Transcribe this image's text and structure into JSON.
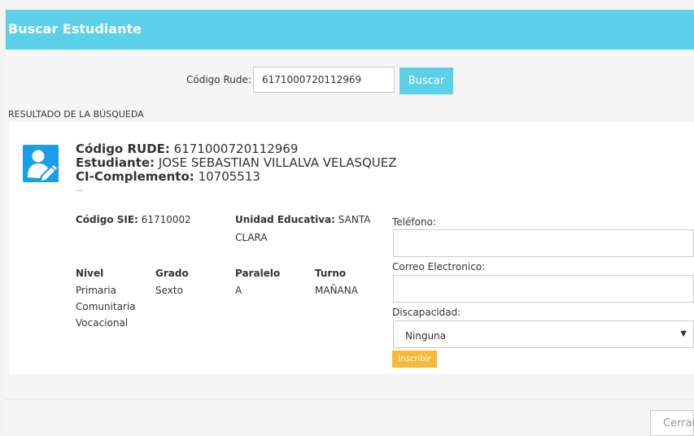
{
  "header": {
    "title": "Buscar Estudiante"
  },
  "search": {
    "label": "Código Rude:",
    "value": "6171000720112969",
    "button_label": "Buscar"
  },
  "results": {
    "heading": "RESULTADO DE LA BÚSQUEDA"
  },
  "student": {
    "rude_label": "Código RUDE:",
    "rude_value": "6171000720112969",
    "name_label": "Estudiante:",
    "name_value": "JOSE SEBASTIAN VILLALVA VELASQUEZ",
    "ci_label": "CI-Complemento:",
    "ci_value": "10705513",
    "dash": "—",
    "sie_label": "Código SIE:",
    "sie_value": "61710002",
    "unidad_label": "Unidad Educativa:",
    "unidad_value_1": "SANTA",
    "unidad_value_2": "CLARA",
    "nivel_label": "Nivel",
    "nivel_lines": [
      "Primaria",
      "Comunitaria",
      "Vocacional"
    ],
    "grado_label": "Grado",
    "grado_value": "Sexto",
    "paralelo_label": "Paralelo",
    "paralelo_value": "A",
    "turno_label": "Turno",
    "turno_value": "MAÑANA"
  },
  "form": {
    "telefono_label": "Teléfono:",
    "telefono_value": "",
    "correo_label": "Correo Electronico:",
    "correo_value": "",
    "discapacidad_label": "Discapacidad:",
    "discapacidad_value": "Ninguna",
    "enroll_label": "Inscribir"
  },
  "footer": {
    "close_label": "Cerrar"
  },
  "icons": {
    "avatar": "user-edit-icon",
    "dropdown": "caret-down-icon"
  },
  "colors": {
    "header": "#5bd0e8",
    "primary_button": "#5bd0e8",
    "avatar": "#1a9ee8",
    "enroll_button": "#f8b93b"
  }
}
